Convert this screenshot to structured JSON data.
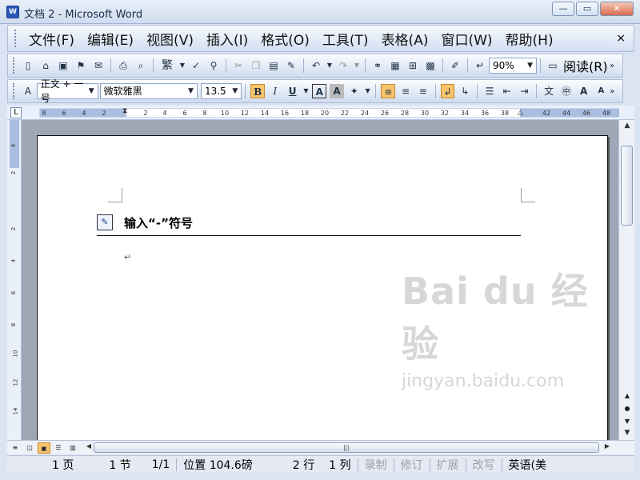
{
  "window": {
    "title": "文档 2 - Microsoft Word",
    "icon": "W",
    "minimize_label": "—",
    "restore_label": "▭",
    "close_label": "✕"
  },
  "menu": {
    "items": [
      "文件(F)",
      "编辑(E)",
      "视图(V)",
      "插入(I)",
      "格式(O)",
      "工具(T)",
      "表格(A)",
      "窗口(W)",
      "帮助(H)"
    ],
    "close": "×"
  },
  "toolbar_standard": {
    "traditional_label": "繁",
    "zoom": "90%",
    "read_label": "阅读(R)"
  },
  "toolbar_format": {
    "style": "正文 + 一号",
    "font": "微软雅黑",
    "size": "13.5",
    "bold": "B",
    "italic": "I",
    "underline": "U",
    "font_color": "A",
    "char_shade": "A"
  },
  "ruler": {
    "h_numbers": [
      "8",
      "6",
      "4",
      "2",
      "2",
      "4",
      "6",
      "8",
      "10",
      "12",
      "14",
      "16",
      "18",
      "20",
      "22",
      "24",
      "26",
      "28",
      "30",
      "32",
      "34",
      "36",
      "38",
      "42",
      "44",
      "46",
      "48"
    ],
    "corner": "L",
    "v_numbers": [
      "4",
      "2",
      "2",
      "4",
      "6",
      "8",
      "10",
      "12",
      "14"
    ]
  },
  "document": {
    "heading": "输入“-”符号",
    "paragraph_mark": "↵"
  },
  "watermark": {
    "brand": "Bai du 经验",
    "url": "jingyan.baidu.com"
  },
  "statusbar": {
    "page": "1 页",
    "section": "1 节",
    "pages": "1/1",
    "position": "位置 104.6磅",
    "line": "2 行",
    "column": "1 列",
    "rec": "录制",
    "trk": "修订",
    "ext": "扩展",
    "ovr": "改写",
    "language": "英语(美"
  },
  "colors": {
    "accent": "#f8c46d",
    "titlebar": "#cfdcee"
  }
}
